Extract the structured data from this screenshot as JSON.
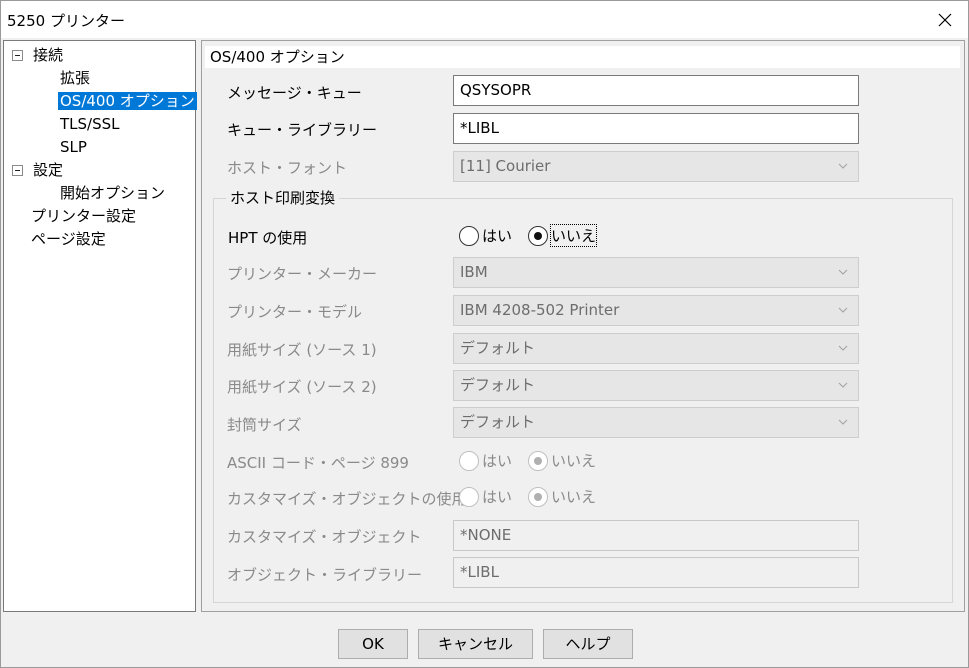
{
  "window": {
    "title": "5250 プリンター"
  },
  "tree": {
    "items": [
      {
        "label": "接続",
        "expanded": true
      },
      {
        "label": "拡張"
      },
      {
        "label": "OS/400 オプション",
        "selected": true
      },
      {
        "label": "TLS/SSL"
      },
      {
        "label": "SLP"
      },
      {
        "label": "設定",
        "expanded": true
      },
      {
        "label": "開始オプション"
      },
      {
        "label": "プリンター設定"
      },
      {
        "label": "ページ設定"
      }
    ]
  },
  "panel": {
    "header": "OS/400 オプション",
    "message_queue": {
      "label": "メッセージ・キュー",
      "value": "QSYSOPR"
    },
    "queue_library": {
      "label": "キュー・ライブラリー",
      "value": "*LIBL"
    },
    "host_font": {
      "label": "ホスト・フォント",
      "value": "[11]  Courier"
    },
    "group": {
      "title": "ホスト印刷変換",
      "hpt": {
        "label": "HPT の使用",
        "yes": "はい",
        "no": "いいえ",
        "selected": "いいえ"
      },
      "maker": {
        "label": "プリンター・メーカー",
        "value": "IBM"
      },
      "model": {
        "label": "プリンター・モデル",
        "value": "IBM 4208-502 Printer"
      },
      "paper1": {
        "label": "用紙サイズ (ソース 1)",
        "value": "デフォルト"
      },
      "paper2": {
        "label": "用紙サイズ (ソース 2)",
        "value": "デフォルト"
      },
      "envelope": {
        "label": "封筒サイズ",
        "value": "デフォルト"
      },
      "ascii899": {
        "label": "ASCII コード・ページ 899",
        "yes": "はい",
        "no": "いいえ",
        "selected": "いいえ"
      },
      "custom_use": {
        "label": "カスタマイズ・オブジェクトの使用",
        "yes": "はい",
        "no": "いいえ",
        "selected": "いいえ"
      },
      "custom_obj": {
        "label": "カスタマイズ・オブジェクト",
        "value": "*NONE"
      },
      "obj_lib": {
        "label": "オブジェクト・ライブラリー",
        "value": "*LIBL"
      }
    }
  },
  "buttons": {
    "ok": "OK",
    "cancel": "キャンセル",
    "help": "ヘルプ"
  }
}
